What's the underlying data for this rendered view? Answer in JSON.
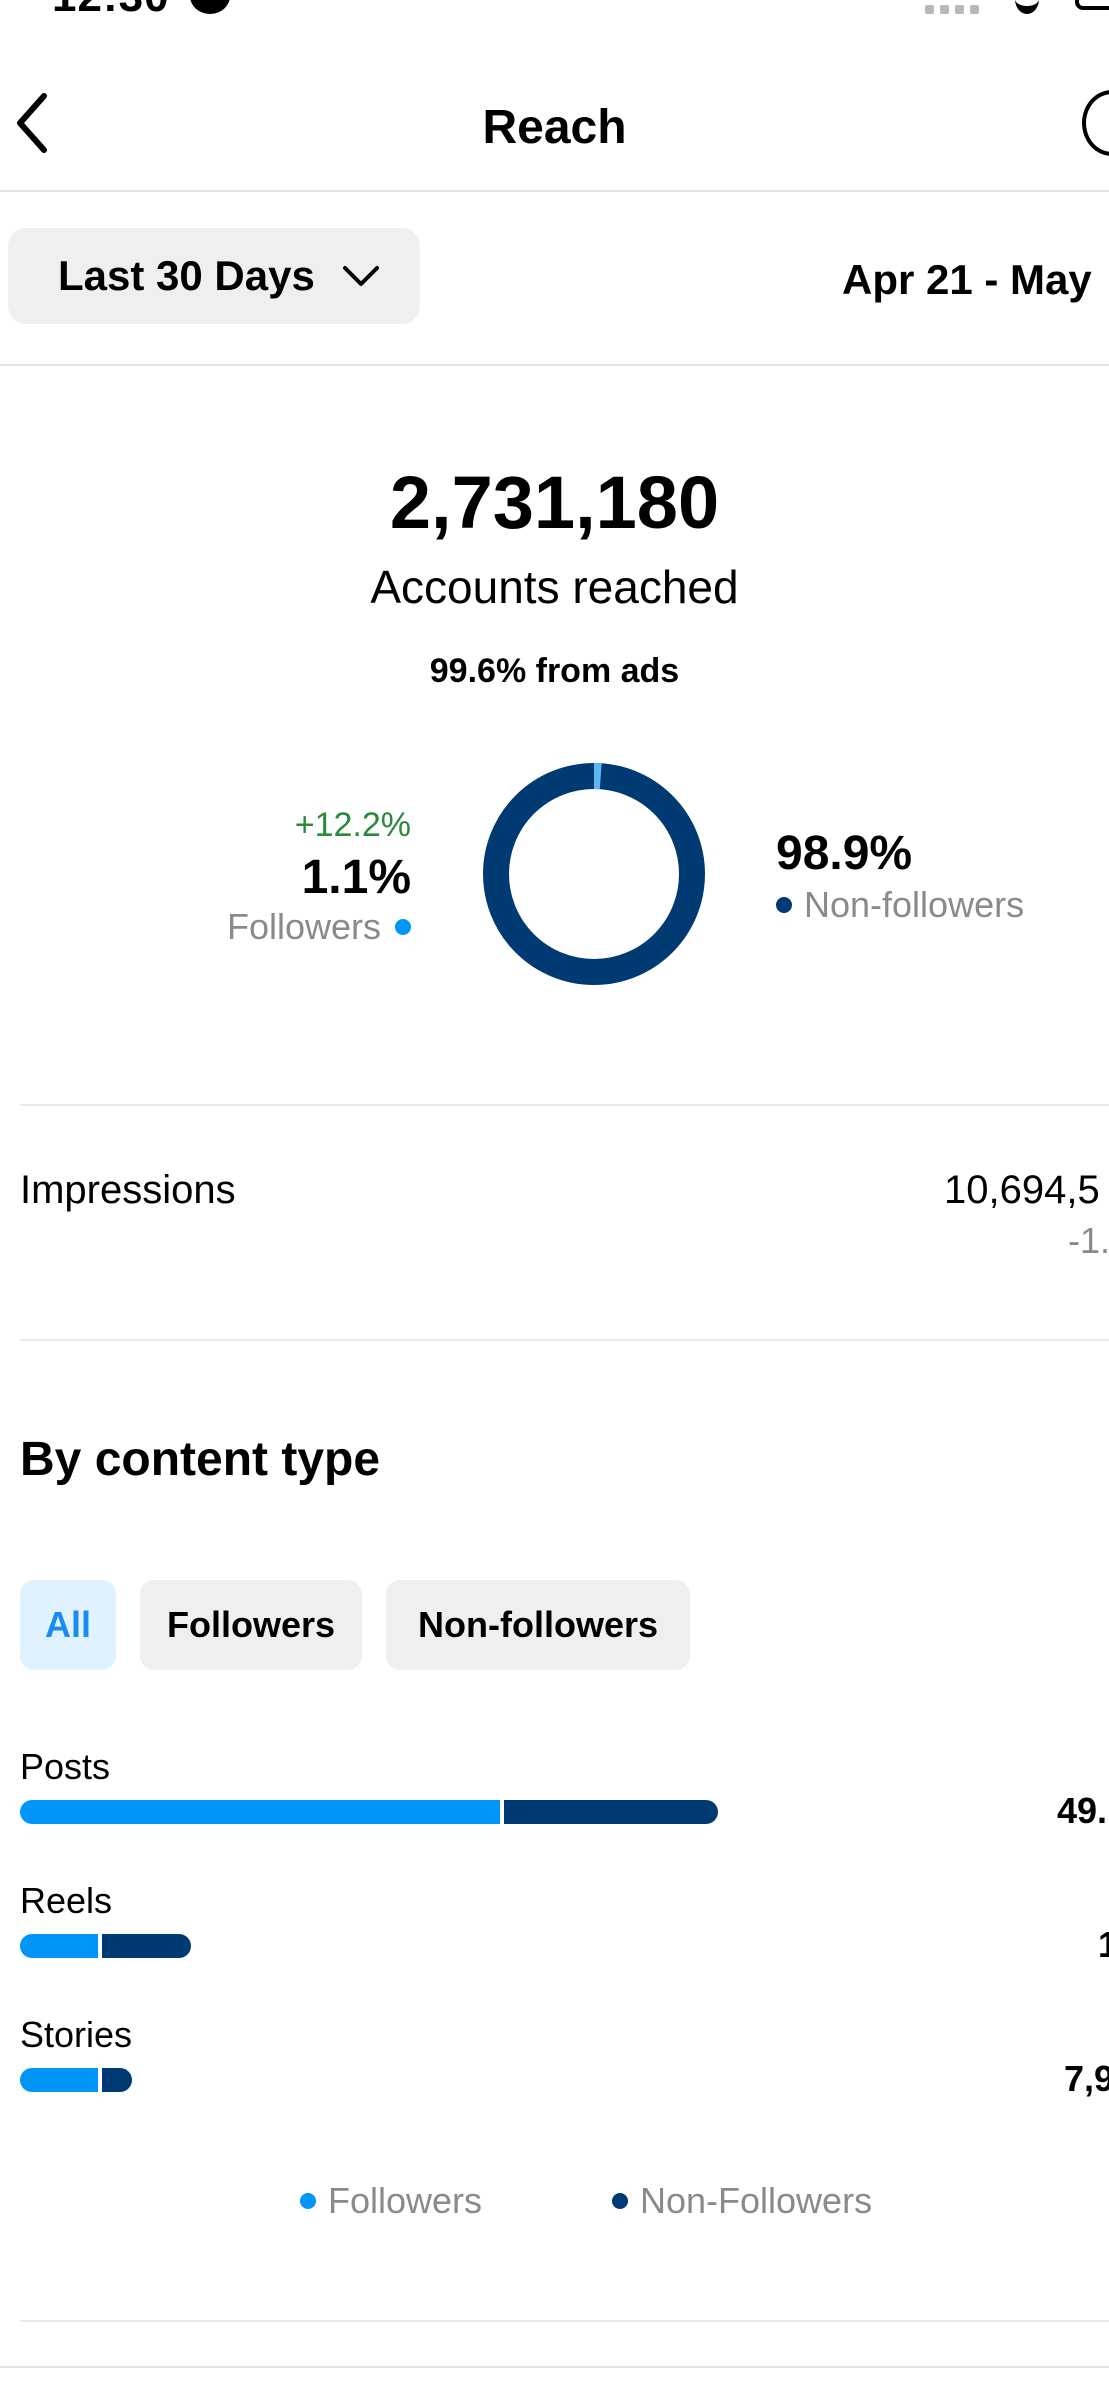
{
  "status_bar": {
    "time": "12:30"
  },
  "header": {
    "title": "Reach",
    "back_icon": "chevron-left-icon",
    "info_icon": "info-icon"
  },
  "filter": {
    "range_label": "Last 30 Days",
    "date_range": "Apr 21 - May"
  },
  "summary": {
    "total": "2,731,180",
    "total_label": "Accounts reached",
    "ads_line": "99.6% from ads"
  },
  "donut": {
    "followers": {
      "change": "+12.2%",
      "percent": "1.1%",
      "label": "Followers",
      "value": 1.1
    },
    "non_followers": {
      "percent": "98.9%",
      "label": "Non-followers",
      "value": 98.9
    }
  },
  "impressions": {
    "label": "Impressions",
    "value": "10,694,5",
    "change": "-1."
  },
  "content_type": {
    "title": "By content type",
    "chips": [
      "All",
      "Followers",
      "Non-followers"
    ],
    "rows": [
      {
        "label": "Posts",
        "value": "49.",
        "followers_share": 0.69,
        "total_fraction": 1.0
      },
      {
        "label": "Reels",
        "value": "1",
        "followers_share": 0.47,
        "total_fraction": 0.245
      },
      {
        "label": "Stories",
        "value": "7,9",
        "followers_share": 0.72,
        "total_fraction": 0.16
      }
    ],
    "legend": {
      "followers": "Followers",
      "non_followers": "Non-Followers"
    }
  },
  "colors": {
    "followers": "#0095f6",
    "non_followers": "#003a73",
    "accent": "#1a8cf0",
    "positive": "#2a8a3e"
  }
}
